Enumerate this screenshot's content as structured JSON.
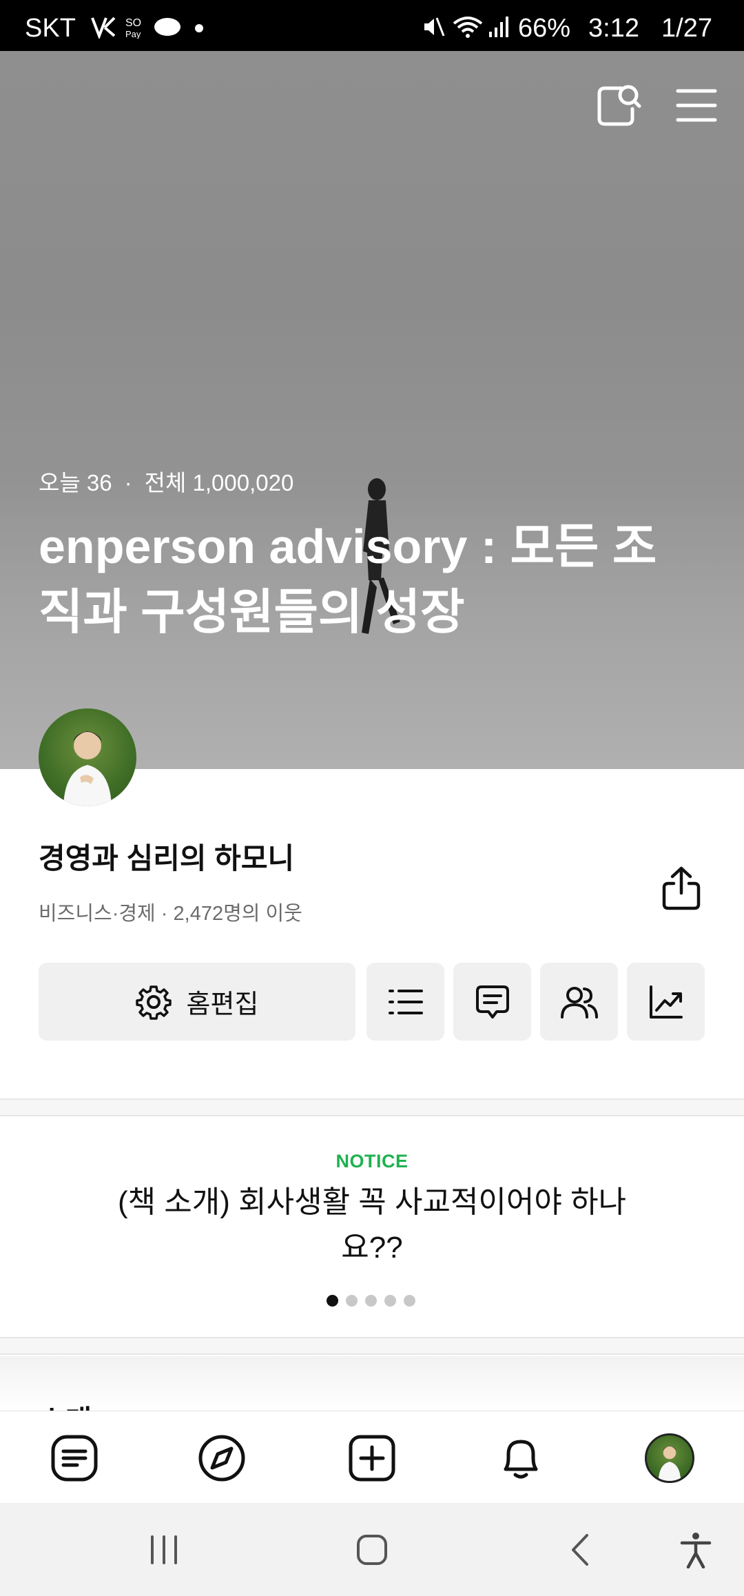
{
  "status_bar": {
    "carrier": "SKT",
    "battery": "66%",
    "time": "3:12",
    "date": "1/27"
  },
  "hero": {
    "today_label": "오늘 36",
    "total_label": "전체 1,000,020",
    "title": "enperson advisory : 모든 조직과 구성원들의 성장"
  },
  "blog": {
    "name": "경영과 심리의 하모니",
    "meta": "비즈니스·경제 · 2,472명의 이웃"
  },
  "actions": {
    "home_edit_label": "홈편집"
  },
  "notice": {
    "label": "NOTICE",
    "title": "(책 소개) 회사생활 꼭 사교적이어야 하나요??",
    "page_count": 5,
    "active_page": 1
  },
  "next_section": {
    "peek_text": "소개"
  },
  "icons": {
    "search": "search-icon",
    "menu": "menu-icon",
    "share": "share-icon",
    "settings": "gear-icon",
    "list": "list-icon",
    "comment": "comment-icon",
    "neighbors": "people-icon",
    "stats": "chart-icon"
  },
  "colors": {
    "notice_green": "#1fb150",
    "button_bg": "#f0f0f0"
  }
}
